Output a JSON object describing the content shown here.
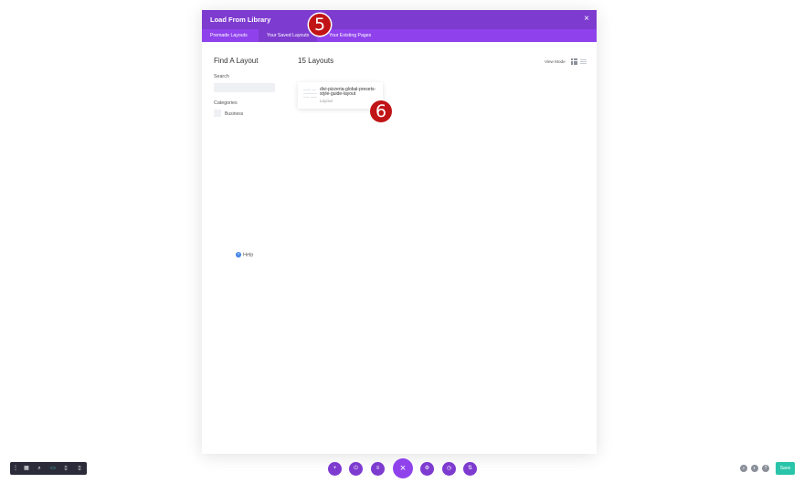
{
  "modal": {
    "title": "Load From Library",
    "close_icon": "×",
    "tabs": [
      {
        "label": "Premade Layouts",
        "active": false
      },
      {
        "label": "Your Saved Layouts",
        "active": true
      },
      {
        "label": "Your Existing Pages",
        "active": false
      }
    ]
  },
  "sidebar": {
    "title": "Find A Layout",
    "search_label": "Search",
    "search_value": "",
    "categories_label": "Categories",
    "categories": [
      {
        "label": "Business",
        "checked": false
      }
    ]
  },
  "main": {
    "count_title": "15 Layouts",
    "view_mode_label": "View Mode",
    "layouts": [
      {
        "name": "divi-pizzeria-global-presets-style-guide-layout",
        "type": "Layout"
      }
    ]
  },
  "help": {
    "label": "Help",
    "icon": "?"
  },
  "badges": {
    "step5": "5",
    "step6": "6"
  },
  "left_toolbar": {
    "items": [
      "more-icon",
      "wireframe-icon",
      "zoom-icon",
      "desktop-icon",
      "tablet-icon",
      "phone-icon"
    ],
    "glyphs": [
      "⋮",
      "▦",
      "⌕",
      "▭",
      "▯",
      "▯"
    ]
  },
  "center_toolbar": {
    "glyphs": [
      "+",
      "⏻",
      "≡",
      "×",
      "⚙",
      "◷",
      "⇅"
    ],
    "items": [
      "add-icon",
      "power-icon",
      "layers-icon",
      "close-icon",
      "settings-icon",
      "history-icon",
      "portability-icon"
    ]
  },
  "right_toolbar": {
    "glyphs": [
      "⌕",
      "◐",
      "?"
    ],
    "items": [
      "search-icon",
      "layers-icon",
      "help-icon"
    ],
    "save_label": "Save"
  },
  "colors": {
    "header": "#7e3bd0",
    "tabbar": "#8f42ec",
    "badge": "#c11416",
    "save": "#29c4a9",
    "toolbar_dark": "#2b2b3a"
  }
}
